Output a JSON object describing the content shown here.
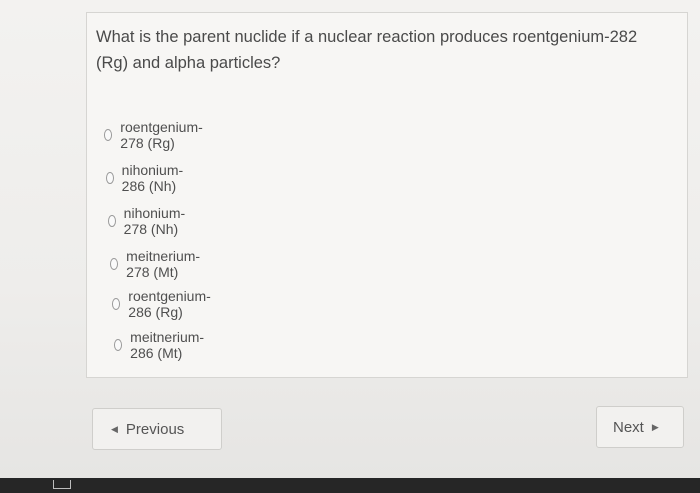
{
  "question": {
    "text": "What is the parent nuclide if a nuclear reaction produces roentgenium-282 (Rg) and alpha particles?"
  },
  "options": [
    {
      "label": "roentgenium-278 (Rg)"
    },
    {
      "label": "nihonium-286 (Nh)"
    },
    {
      "label": "nihonium-278 (Nh)"
    },
    {
      "label": "meitnerium-278 (Mt)"
    },
    {
      "label": "roentgenium-286 (Rg)"
    },
    {
      "label": "meitnerium-286 (Mt)"
    }
  ],
  "navigation": {
    "previous_label": "Previous",
    "next_label": "Next",
    "previous_icon": "left-triangle-icon",
    "next_icon": "right-triangle-icon"
  }
}
